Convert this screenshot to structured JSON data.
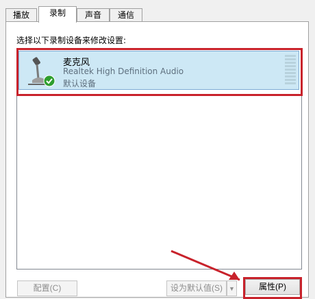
{
  "tabs": [
    {
      "label": "播放"
    },
    {
      "label": "录制"
    },
    {
      "label": "声音"
    },
    {
      "label": "通信"
    }
  ],
  "active_tab": "录制",
  "instruction": "选择以下录制设备来修改设置:",
  "device": {
    "name": "麦克风",
    "driver": "Realtek High Definition Audio",
    "status": "默认设备",
    "icon": "microphone-icon",
    "default_check_icon": "check-icon"
  },
  "buttons": {
    "configure": "配置(C)",
    "set_default": "设为默认值(S)",
    "properties": "属性(P)"
  },
  "colors": {
    "selection": "#cde8f5",
    "annotation_red": "#c8222b",
    "check_green": "#2e9e2e"
  }
}
